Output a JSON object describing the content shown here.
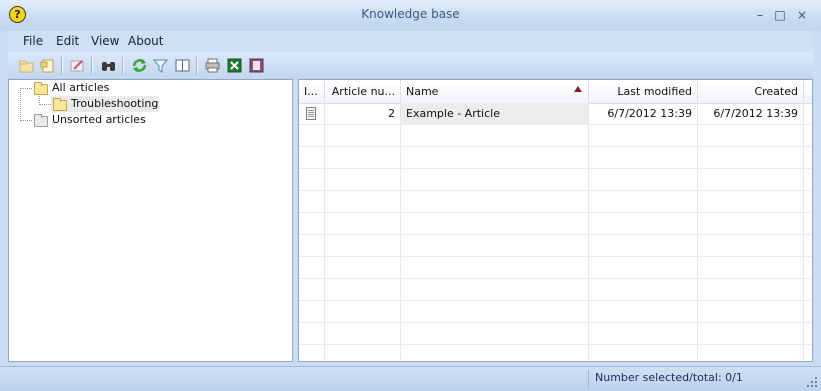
{
  "window": {
    "title": "Knowledge base",
    "app_icon": "?",
    "controls": {
      "minimize": "–",
      "maximize": "□",
      "close": "×"
    }
  },
  "menu": [
    "File",
    "Edit",
    "View",
    "About"
  ],
  "toolbar": {
    "icons": [
      "new-folder-icon",
      "new-article-icon",
      "edit-icon",
      "find-icon",
      "refresh-icon",
      "filter-icon",
      "panel-icon",
      "print-icon",
      "excel-export-icon",
      "film-icon"
    ]
  },
  "tree": {
    "root": "All articles",
    "child": "Troubleshooting",
    "unsorted": "Unsorted articles"
  },
  "grid": {
    "columns": [
      "I...",
      "Article nu...",
      "Name",
      "Last modified",
      "Created"
    ],
    "sort_column": "Name",
    "rows": [
      {
        "number": "2",
        "name": "Example - Article",
        "last_modified": "6/7/2012 13:39",
        "created": "6/7/2012 13:39"
      }
    ]
  },
  "status": {
    "text": "Number selected/total: 0/1"
  },
  "colors": {
    "accent": "#c9dcf2",
    "sort_arrow": "#8a1e2e",
    "title_text": "#3b5a88"
  }
}
